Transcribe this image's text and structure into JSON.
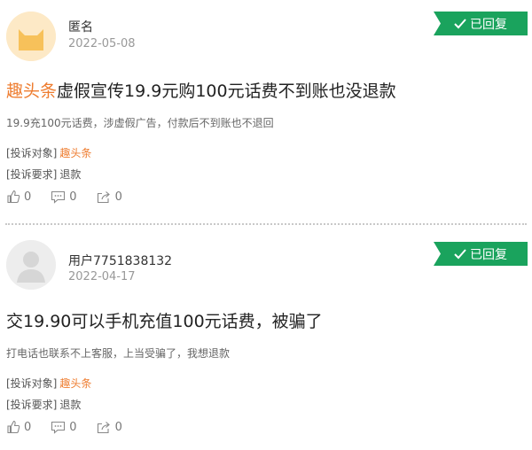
{
  "complaints": [
    {
      "avatar": "cat-avatar",
      "user": "匿名",
      "date": "2022-05-08",
      "status": "已回复",
      "title_brand": "趣头条",
      "title_rest": "虚假宣传19.9元购100元话费不到账也没退款",
      "description": "19.9充100元话费，涉虚假广告，付款后不到账也不退回",
      "target_label": "[投诉对象]",
      "target_value": "趣头条",
      "request_label": "[投诉要求]",
      "request_value": "退款",
      "likes": "0",
      "comments": "0",
      "shares": "0"
    },
    {
      "avatar": "default-avatar",
      "user": "用户7751838132",
      "date": "2022-04-17",
      "status": "已回复",
      "title_brand": "",
      "title_rest": "交19.90可以手机充值100元话费，被骗了",
      "description": "打电话也联系不上客服，上当受骗了，我想退款",
      "target_label": "[投诉对象]",
      "target_value": "趣头条",
      "request_label": "[投诉要求]",
      "request_value": "退款",
      "likes": "0",
      "comments": "0",
      "shares": "0"
    }
  ],
  "colors": {
    "brand_orange": "#ee7c2f",
    "status_green": "#1aa35d"
  },
  "icons": [
    "thumbs-up-icon",
    "comment-icon",
    "share-icon",
    "check-icon"
  ]
}
